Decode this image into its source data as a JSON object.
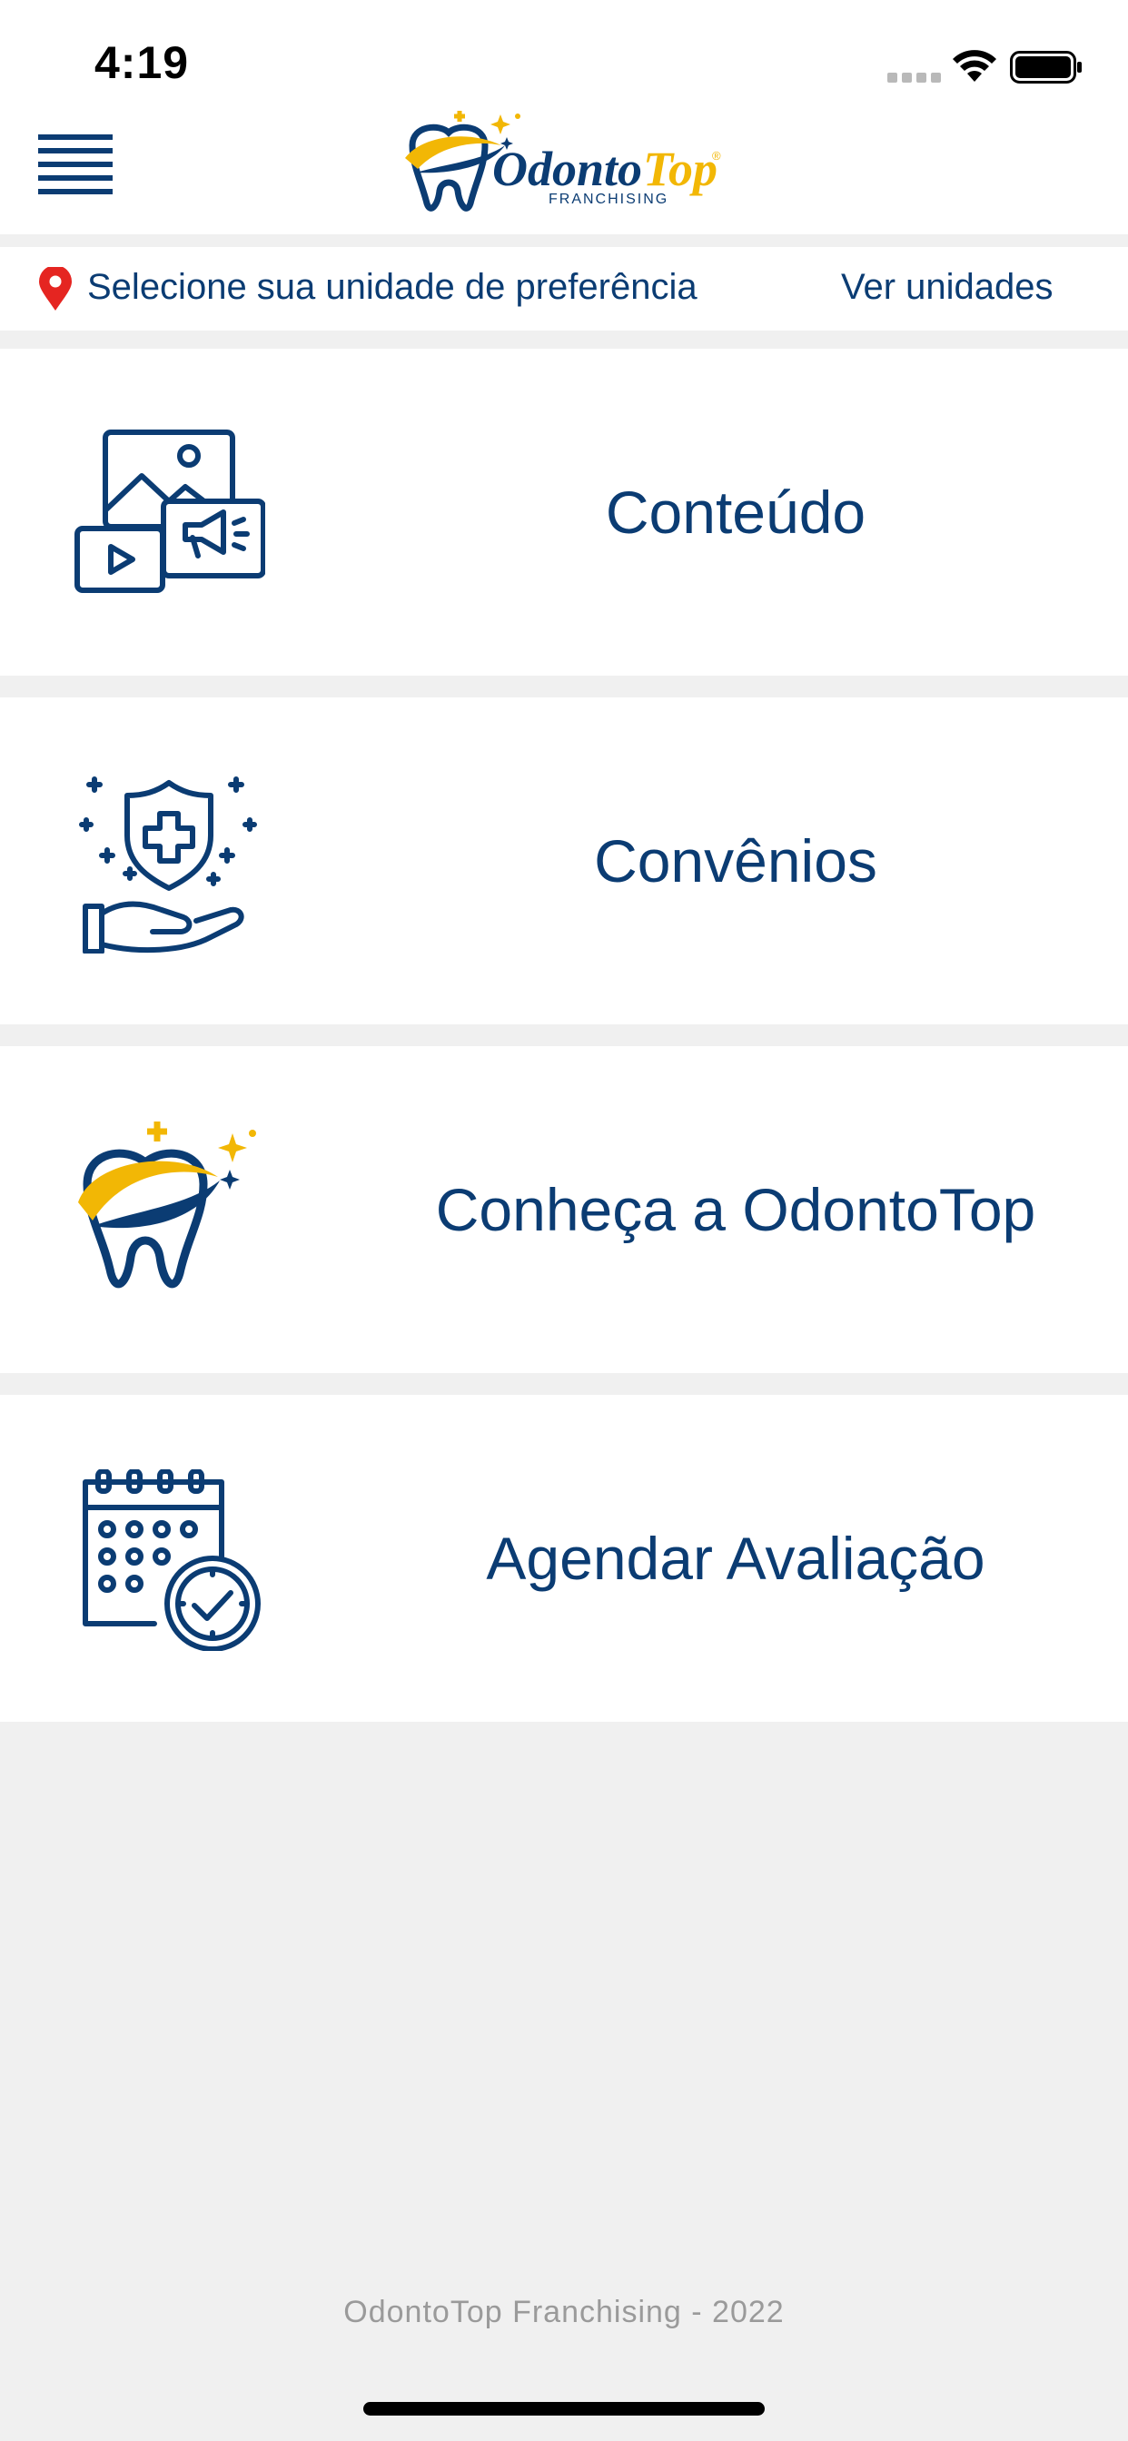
{
  "status_bar": {
    "time": "4:19",
    "icons": [
      "cellular-signal-icon",
      "wifi-icon",
      "battery-icon"
    ]
  },
  "header": {
    "logo": {
      "name": "OdontoTop",
      "brand_part1": "Odonto",
      "brand_part2": "Top",
      "tagline": "FRANCHISING",
      "registered": "®"
    },
    "menu_icon": "hamburger-menu-icon"
  },
  "location": {
    "icon": "location-pin-icon",
    "text": "Selecione sua unidade de preferência",
    "link": "Ver unidades"
  },
  "menu_items": [
    {
      "label": "Conteúdo",
      "icon": "media-content-icon"
    },
    {
      "label": "Convênios",
      "icon": "health-insurance-hand-icon"
    },
    {
      "label": "Conheça a OdontoTop",
      "icon": "odontotop-tooth-icon"
    },
    {
      "label": "Agendar Avaliação",
      "icon": "calendar-clock-icon"
    }
  ],
  "footer": {
    "text": "OdontoTop Franchising - 2022"
  },
  "colors": {
    "primary": "#0b3c73",
    "accent_yellow": "#f2b705",
    "pin_red": "#e52521",
    "background": "#f0f0f0",
    "footer_text": "#9a9a9a"
  }
}
